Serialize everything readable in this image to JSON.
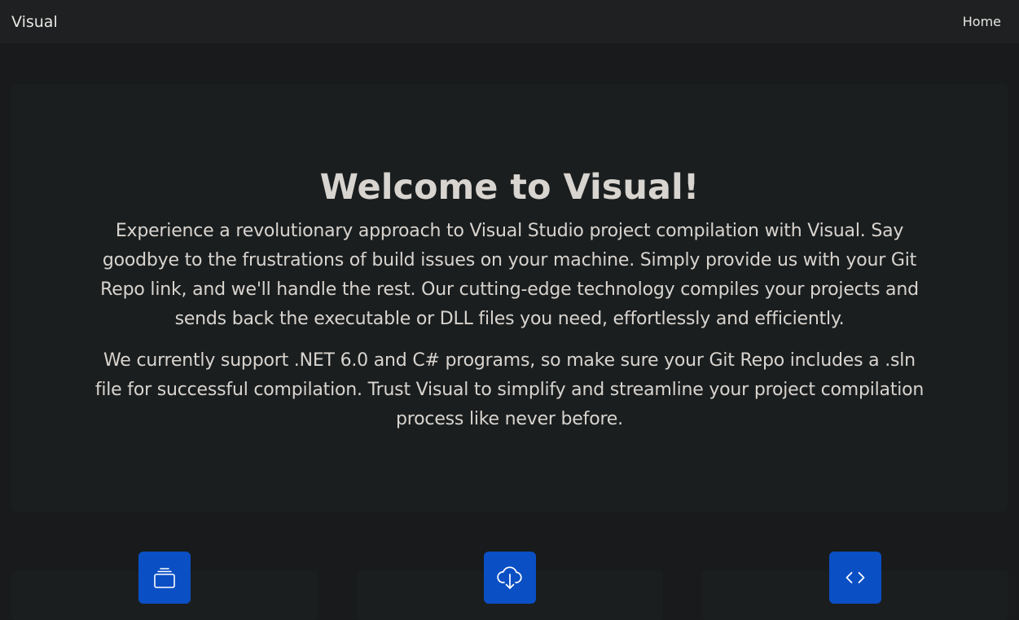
{
  "navbar": {
    "brand": "Visual",
    "links": [
      {
        "label": "Home"
      }
    ]
  },
  "hero": {
    "title": "Welcome to Visual!",
    "paragraphs": [
      "Experience a revolutionary approach to Visual Studio project compilation with Visual. Say goodbye to the frustrations of build issues on your machine. Simply provide us with your Git Repo link, and we'll handle the rest. Our cutting-edge technology compiles your projects and sends back the executable or DLL files you need, effortlessly and efficiently.",
      "We currently support .NET 6.0 and C# programs, so make sure your Git Repo includes a .sln file for successful compilation. Trust Visual to simplify and streamline your project compilation process like never before."
    ]
  },
  "features": [
    {
      "icon": "collection-icon"
    },
    {
      "icon": "cloud-download-icon"
    },
    {
      "icon": "code-icon"
    }
  ],
  "colors": {
    "background": "#181a1b",
    "navbar": "#1e2021",
    "panel": "#1b1e1f",
    "text": "#d8d4cf",
    "accent": "#0a4fc4"
  }
}
